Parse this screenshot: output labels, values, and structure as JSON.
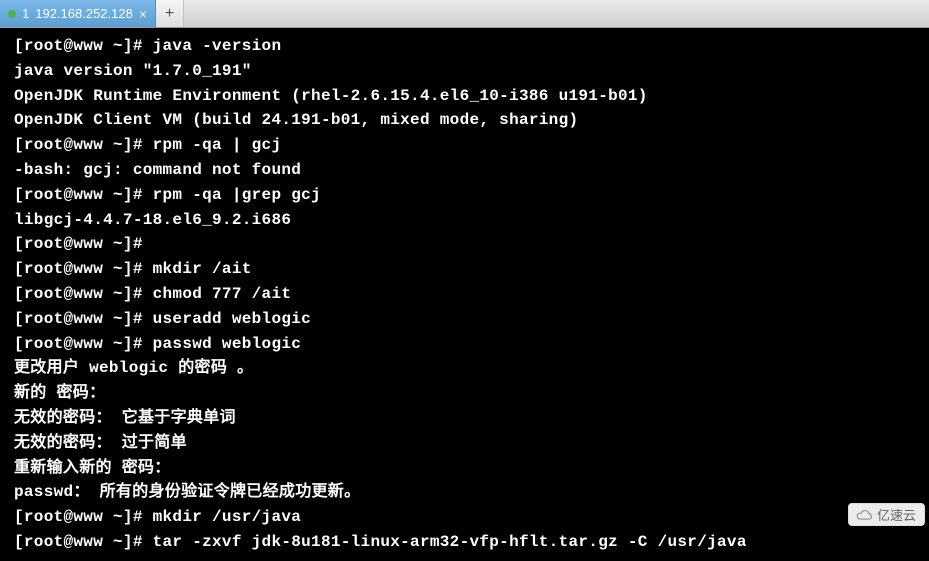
{
  "tab": {
    "index": "1",
    "title": "192.168.252.128",
    "close": "×",
    "add": "+"
  },
  "terminal": {
    "lines": [
      "[root@www ~]# java -version",
      "java version \"1.7.0_191\"",
      "OpenJDK Runtime Environment (rhel-2.6.15.4.el6_10-i386 u191-b01)",
      "OpenJDK Client VM (build 24.191-b01, mixed mode, sharing)",
      "[root@www ~]# rpm -qa | gcj",
      "-bash: gcj: command not found",
      "[root@www ~]# rpm -qa |grep gcj",
      "libgcj-4.4.7-18.el6_9.2.i686",
      "[root@www ~]#",
      "[root@www ~]# mkdir /ait",
      "[root@www ~]# chmod 777 /ait",
      "[root@www ~]# useradd weblogic",
      "[root@www ~]# passwd weblogic",
      "更改用户 weblogic 的密码 。",
      "新的 密码：",
      "无效的密码： 它基于字典单词",
      "无效的密码： 过于简单",
      "重新输入新的 密码：",
      "passwd： 所有的身份验证令牌已经成功更新。",
      "[root@www ~]# mkdir /usr/java",
      "[root@www ~]# tar -zxvf jdk-8u181-linux-arm32-vfp-hflt.tar.gz -C /usr/java"
    ]
  },
  "watermark": {
    "text": "亿速云"
  }
}
